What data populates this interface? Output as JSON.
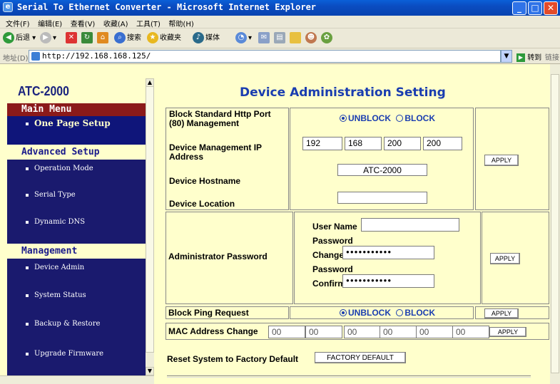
{
  "window": {
    "title": "Serial To Ethernet Converter - Microsoft Internet Explorer"
  },
  "menubar": [
    "文件(F)",
    "编辑(E)",
    "查看(V)",
    "收藏(A)",
    "工具(T)",
    "帮助(H)"
  ],
  "toolbar": {
    "back": "后退",
    "search": "搜索",
    "favorites": "收藏夹",
    "media": "媒体"
  },
  "address": {
    "label": "地址(D)",
    "url": "http://192.168.168.125/",
    "go": "转到",
    "links": "链接"
  },
  "sidebar": {
    "logo": "ATC-2000",
    "main_menu": "Main Menu",
    "one_page_setup": "One Page Setup",
    "advanced_setup": "Advanced Setup",
    "advanced_items": [
      "Operation Mode",
      "Serial Type",
      "Dynamic DNS"
    ],
    "management": "Management",
    "management_items": [
      "Device Admin",
      "System Status",
      "Backup & Restore",
      "Upgrade Firmware"
    ]
  },
  "page": {
    "title": "Device Administration Setting",
    "http_port_label": "Block Standard Http Port (80) Management",
    "unblock": "UNBLOCK",
    "block": "BLOCK",
    "ip_label": "Device Management IP Address",
    "ip": [
      "192",
      "168",
      "200",
      "200"
    ],
    "hostname_label": "Device Hostname",
    "hostname": "ATC-2000",
    "location_label": "Device Location",
    "location": "",
    "apply": "APPLY",
    "admin_pw_label": "Administrator Password",
    "user_name_label": "User Name",
    "user_name": "",
    "pw_change_label_1": "Password",
    "pw_change_label_2": "Change",
    "pw_change_value": "●●●●●●●●●●●",
    "pw_confirm_label_1": "Password",
    "pw_confirm_label_2": "Confirm",
    "pw_confirm_value": "●●●●●●●●●●●",
    "ping_label": "Block Ping Request",
    "mac_label": "MAC Address Change",
    "mac": [
      "00",
      "00",
      "00",
      "00",
      "00",
      "00"
    ],
    "reset_label": "Reset System to Factory Default",
    "factory_default": "FACTORY DEFAULT"
  }
}
